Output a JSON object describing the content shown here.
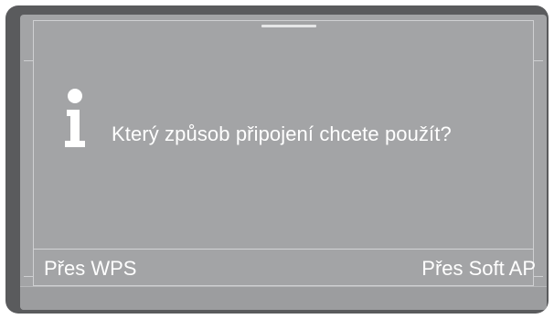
{
  "dialog": {
    "icon": "info-icon",
    "message": "Který způsob připojení chcete použít?"
  },
  "options": {
    "left_label": "Přes WPS",
    "right_label": "Přes Soft AP"
  },
  "colors": {
    "bezel": "#5a5b5d",
    "screen": "#a3a4a6",
    "text": "#ffffff"
  }
}
